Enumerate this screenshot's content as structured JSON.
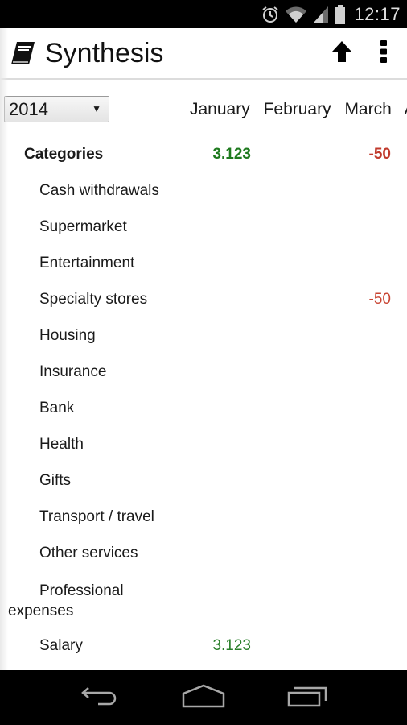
{
  "status_bar": {
    "icons": [
      "alarm-icon",
      "wifi-icon",
      "cell-signal-icon",
      "battery-icon"
    ],
    "time": "12:17"
  },
  "action_bar": {
    "app_icon": "book-icon",
    "title": "Synthesis",
    "actions": [
      {
        "icon": "arrow-up-icon",
        "label": "Upload"
      },
      {
        "icon": "overflow-menu-icon",
        "label": "More options"
      }
    ]
  },
  "year_selector": {
    "value": "2014",
    "caret": "▼"
  },
  "months": [
    "January",
    "February",
    "March",
    "A"
  ],
  "colors": {
    "positive": "#2a7f2a",
    "negative": "#c84432"
  },
  "table": {
    "header": {
      "label": "Categories",
      "january": "3.123",
      "march": "-50"
    },
    "rows": [
      {
        "label": "Cash withdrawals",
        "january": "",
        "march": ""
      },
      {
        "label": "Supermarket",
        "january": "",
        "march": ""
      },
      {
        "label": "Entertainment",
        "january": "",
        "march": ""
      },
      {
        "label": "Specialty stores",
        "january": "",
        "march": "-50"
      },
      {
        "label": "Housing",
        "january": "",
        "march": ""
      },
      {
        "label": "Insurance",
        "january": "",
        "march": ""
      },
      {
        "label": "Bank",
        "january": "",
        "march": ""
      },
      {
        "label": "Health",
        "january": "",
        "march": ""
      },
      {
        "label": "Gifts",
        "january": "",
        "march": ""
      },
      {
        "label": "Transport / travel",
        "january": "",
        "march": ""
      },
      {
        "label": "Other services",
        "january": "",
        "march": ""
      },
      {
        "label": "Professional expenses",
        "january": "",
        "march": ""
      },
      {
        "label": "Salary",
        "january": "3.123",
        "march": ""
      }
    ]
  },
  "nav_bar": {
    "buttons": [
      "back-icon",
      "home-icon",
      "recent-apps-icon"
    ]
  }
}
